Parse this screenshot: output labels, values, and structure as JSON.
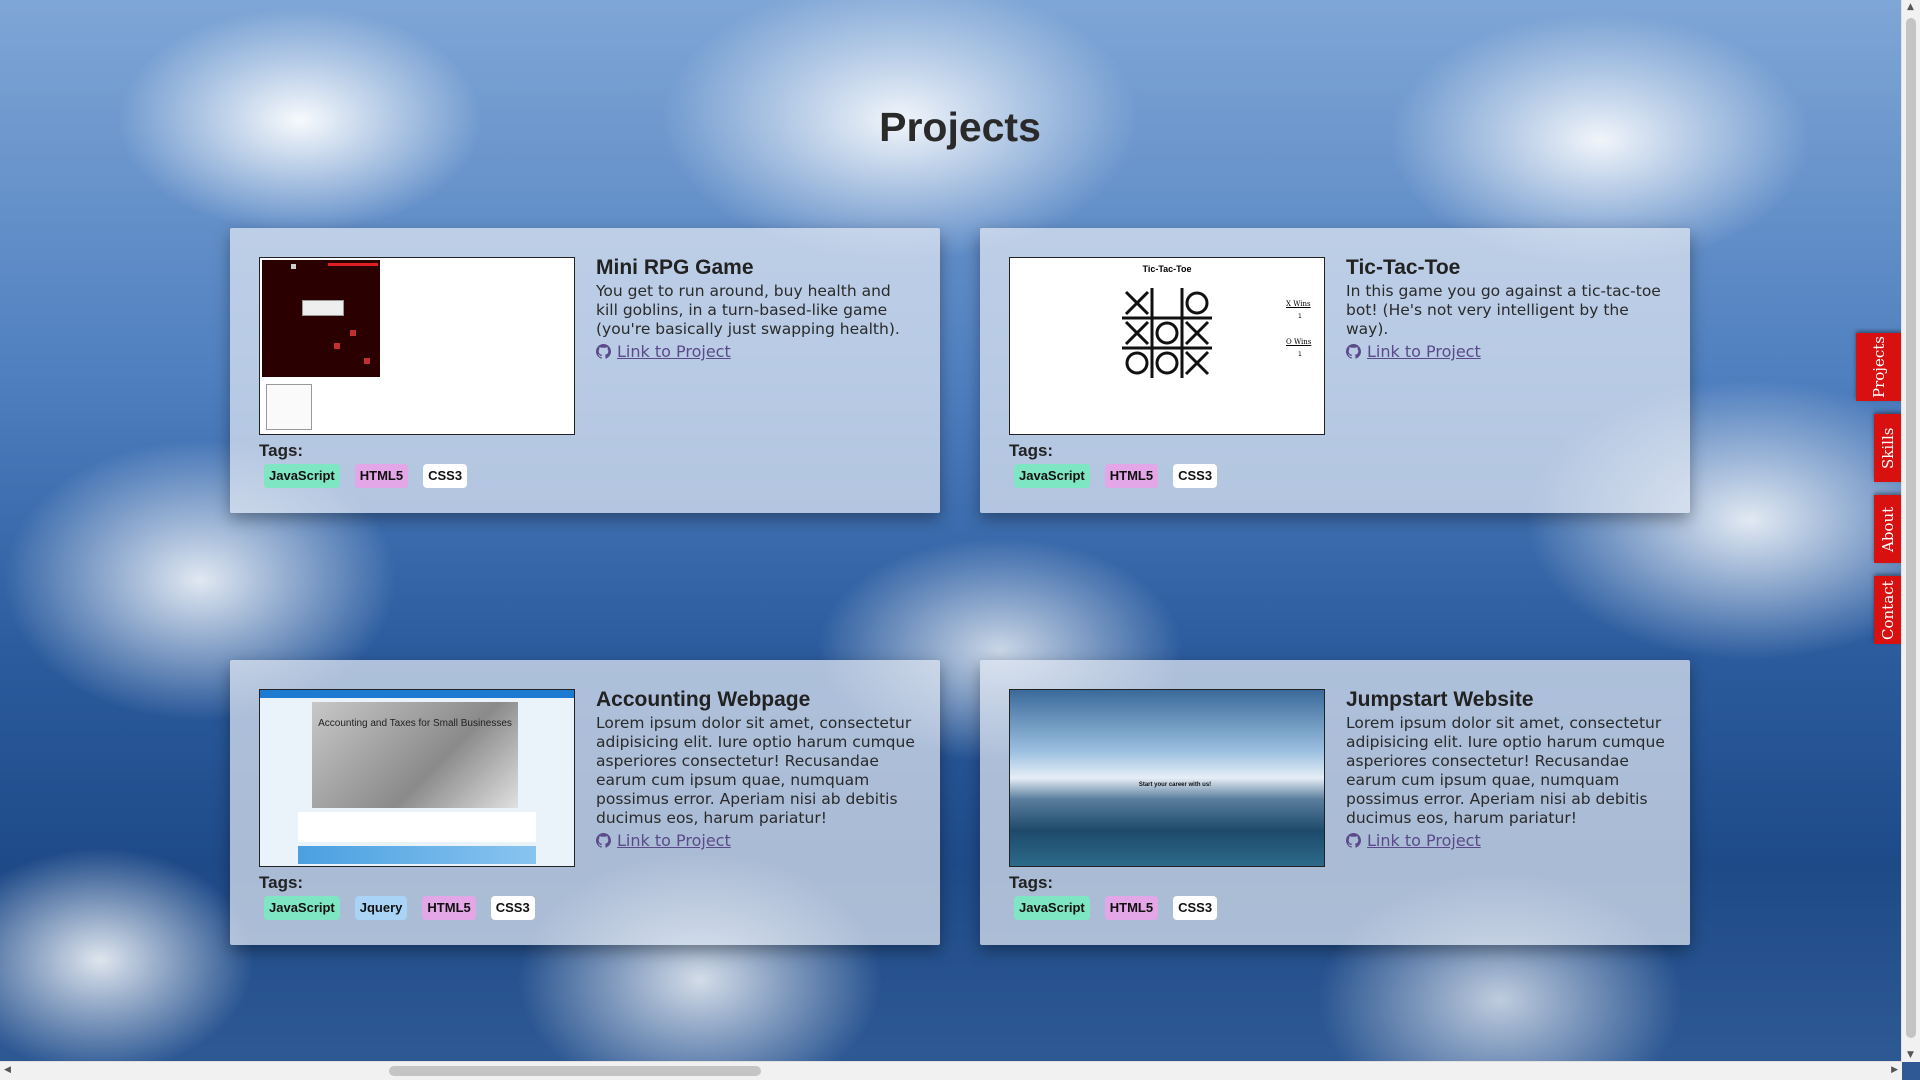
{
  "page": {
    "title": "Projects"
  },
  "projects": [
    {
      "title": "Mini RPG Game",
      "description": "You get to run around, buy health and kill goblins, in a turn-based-like game (you're basically just swapping health).",
      "link": "Link to Project",
      "tags_label": "Tags:",
      "tags": [
        "JavaScript",
        "HTML5",
        "CSS3"
      ]
    },
    {
      "title": "Tic-Tac-Toe",
      "description": "In this game you go against a tic-tac-toe bot! (He's not very intelligent by the way).",
      "link": "Link to Project",
      "tags_label": "Tags:",
      "tags": [
        "JavaScript",
        "HTML5",
        "CSS3"
      ],
      "thumb": {
        "title": "Tic-Tac-Toe",
        "x_wins": "X Wins",
        "o_wins": "O Wins",
        "x_count": "1",
        "o_count": "1"
      }
    },
    {
      "title": "Accounting Webpage",
      "description": "Lorem ipsum dolor sit amet, consectetur adipisicing elit. Iure optio harum cumque asperiores consectetur! Recusandae earum cum ipsum quae, numquam possimus error. Aperiam nisi ab debitis ducimus eos, harum pariatur!",
      "link": "Link to Project",
      "tags_label": "Tags:",
      "tags": [
        "JavaScript",
        "Jquery",
        "HTML5",
        "CSS3"
      ],
      "thumb": {
        "headline": "Accounting and Taxes for Small Businesses"
      }
    },
    {
      "title": "Jumpstart Website",
      "description": "Lorem ipsum dolor sit amet, consectetur adipisicing elit. Iure optio harum cumque asperiores consectetur! Recusandae earum cum ipsum quae, numquam possimus error. Aperiam nisi ab debitis ducimus eos, harum pariatur!",
      "link": "Link to Project",
      "tags_label": "Tags:",
      "tags": [
        "JavaScript",
        "HTML5",
        "CSS3"
      ],
      "thumb": {
        "headline": "Start your career with us!"
      }
    }
  ],
  "nav_tabs": [
    "Projects",
    "Skills",
    "About",
    "Contact"
  ],
  "colors": {
    "tag_javascript": "#7fe6c3",
    "tag_html5": "#e3a6e6",
    "tag_css3": "#ffffff",
    "tag_jquery": "#a9d4f5",
    "nav_tab": "#d81010",
    "link": "#5b4a8a"
  },
  "icons": {
    "link_icon": "github-icon"
  }
}
